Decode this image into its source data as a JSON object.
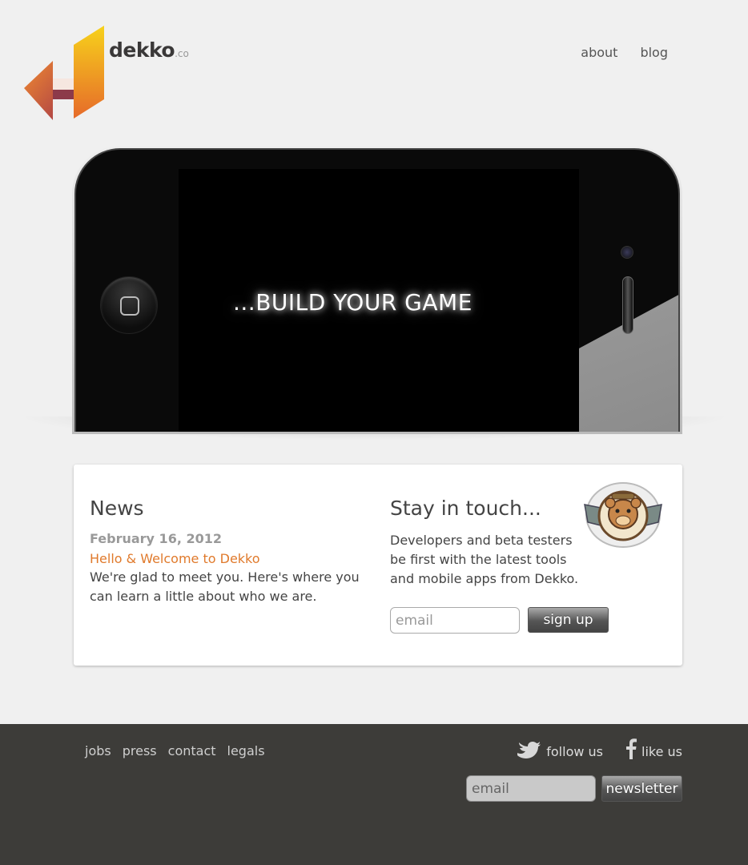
{
  "header": {
    "brand": "dekko",
    "brand_suffix": ".co",
    "nav": [
      {
        "label": "about"
      },
      {
        "label": "blog"
      }
    ]
  },
  "hero": {
    "screen_text": "...BUILD YOUR GAME"
  },
  "news": {
    "heading": "News",
    "date": "February 16, 2012",
    "link": "Hello & Welcome to Dekko",
    "text": "We're glad to meet you. Here's where you can learn a little about who we are."
  },
  "contact": {
    "heading": "Stay in touch...",
    "text": "Developers and beta testers be first with the latest tools and mobile apps from Dekko.",
    "email_placeholder": "email",
    "signup_label": "sign up"
  },
  "footer": {
    "links": [
      "jobs",
      "press",
      "contact",
      "legals"
    ],
    "follow_label": "follow us",
    "like_label": "like us",
    "email_placeholder": "email",
    "newsletter_label": "newsletter"
  },
  "colors": {
    "accent": "#e07a2c",
    "footer_bg": "#3d3c39",
    "page_bg": "#f0f0f0"
  }
}
